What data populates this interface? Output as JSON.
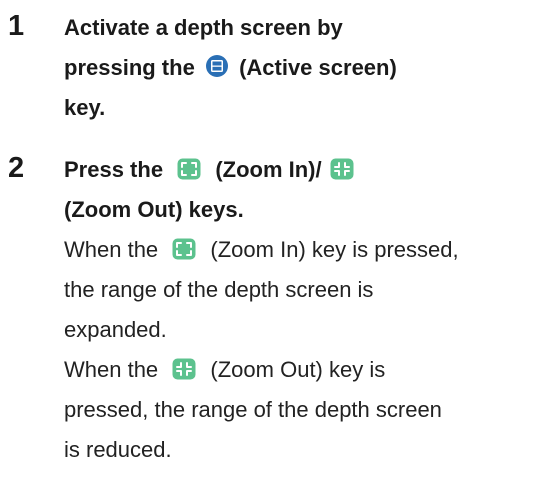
{
  "steps": [
    {
      "number": "1",
      "instruction": {
        "line1": "Activate a depth screen by",
        "line2_before": "pressing the",
        "line2_after": "(Active screen)",
        "line3": "key."
      },
      "icons": {
        "active_screen": "active-screen-key-icon"
      }
    },
    {
      "number": "2",
      "instruction": {
        "line1_before": "Press the",
        "line1_middle": "(Zoom In)/",
        "line2": "(Zoom Out) keys."
      },
      "description": {
        "zoom_in_before": "When the",
        "zoom_in_after": "(Zoom In) key is pressed,",
        "zoom_in_line2": "the range of the depth screen is",
        "zoom_in_line3": "expanded.",
        "zoom_out_before": "When the",
        "zoom_out_after": "(Zoom Out) key is",
        "zoom_out_line2": "pressed, the range of the depth screen",
        "zoom_out_line3": "is reduced."
      },
      "icons": {
        "zoom_in": "zoom-in-key-icon",
        "zoom_out": "zoom-out-key-icon"
      }
    }
  ],
  "colors": {
    "active_screen_icon": "#2a6fb5",
    "zoom_icon": "#5cc28e",
    "text": "#1a1a1a"
  }
}
